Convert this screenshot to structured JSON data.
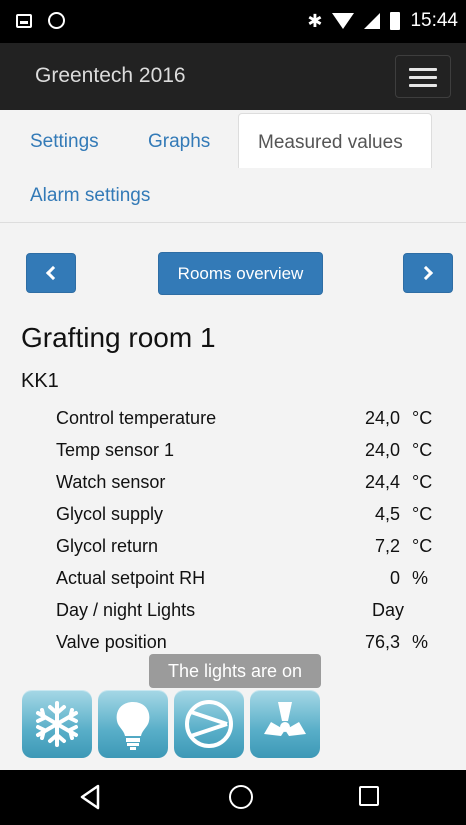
{
  "status_bar": {
    "time": "15:44",
    "bluetooth_icon": "bluetooth-icon"
  },
  "navbar": {
    "brand": "Greentech 2016",
    "menu_icon": "hamburger-icon"
  },
  "tabs": {
    "settings": "Settings",
    "graphs": "Graphs",
    "measured_values": "Measured values",
    "alarm_settings": "Alarm settings",
    "active": "Measured values"
  },
  "pager": {
    "prev_icon": "chevron-left-icon",
    "rooms_overview": "Rooms overview",
    "next_icon": "chevron-right-icon"
  },
  "room": {
    "title": "Grafting room 1",
    "subtitle": "KK1"
  },
  "values": [
    {
      "label": "Control temperature",
      "value": "24,0",
      "unit": "°C"
    },
    {
      "label": "Temp sensor 1",
      "value": "24,0",
      "unit": "°C"
    },
    {
      "label": "Watch sensor",
      "value": "24,4",
      "unit": "°C"
    },
    {
      "label": "Glycol supply",
      "value": "4,5",
      "unit": "°C"
    },
    {
      "label": "Glycol return",
      "value": "7,2",
      "unit": "°C"
    },
    {
      "label": "Actual setpoint RH",
      "value": "0",
      "unit": "%"
    },
    {
      "label": "Day / night Lights",
      "value": "Day",
      "unit": ""
    },
    {
      "label": "Valve position",
      "value": "76,3",
      "unit": "%"
    }
  ],
  "tooltip": "The lights are on",
  "status_icons": [
    "snowflake-icon",
    "lightbulb-icon",
    "pump-icon",
    "fan-icon"
  ],
  "colors": {
    "primary": "#337ab7",
    "navbar": "#222222",
    "icon_tile": "#58aec8"
  }
}
